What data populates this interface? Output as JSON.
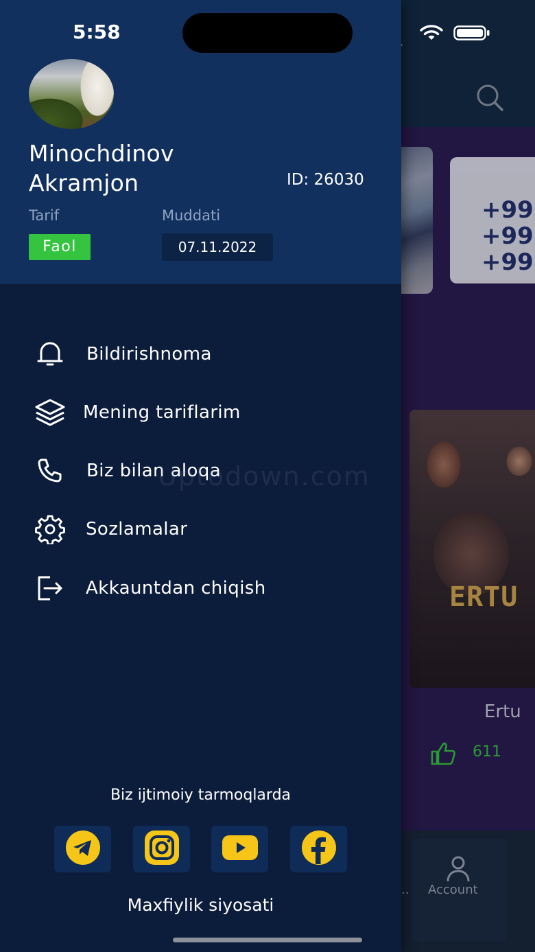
{
  "status_bar": {
    "time": "5:58"
  },
  "profile": {
    "name_line1": "Minochdinov",
    "name_line2": "Akramjon",
    "id_label": "ID: 26030",
    "tariff_label": "Tarif",
    "tariff_status": "Faol",
    "duration_label": "Muddati",
    "duration_date": "07.11.2022"
  },
  "menu": [
    {
      "label": "Bildirishnoma",
      "icon": "bell-icon"
    },
    {
      "label": "Mening tariflarim",
      "icon": "layers-icon"
    },
    {
      "label": "Biz bilan aloqa",
      "icon": "phone-icon"
    },
    {
      "label": "Sozlamalar",
      "icon": "gear-icon"
    },
    {
      "label": "Akkauntdan chiqish",
      "icon": "logout-icon"
    }
  ],
  "social": {
    "title": "Biz ijtimoiy tarmoqlarda",
    "links": [
      "telegram-icon",
      "instagram-icon",
      "youtube-icon",
      "facebook-icon"
    ]
  },
  "privacy_label": "Maxfiylik siyosati",
  "background": {
    "phone_lines": [
      "+99",
      "+99",
      "+99"
    ],
    "poster_title": "ERTU",
    "series_title": "Ertu",
    "likes": "611",
    "tab_dots": "..",
    "tab_account": "Account",
    "status_dots": "....",
    "watermark": "Uptodown.com"
  },
  "colors": {
    "drawer_bg": "#0c1c3b",
    "profile_bg": "#12305e",
    "status_green": "#34c43f",
    "social_yellow": "#f5c518"
  }
}
